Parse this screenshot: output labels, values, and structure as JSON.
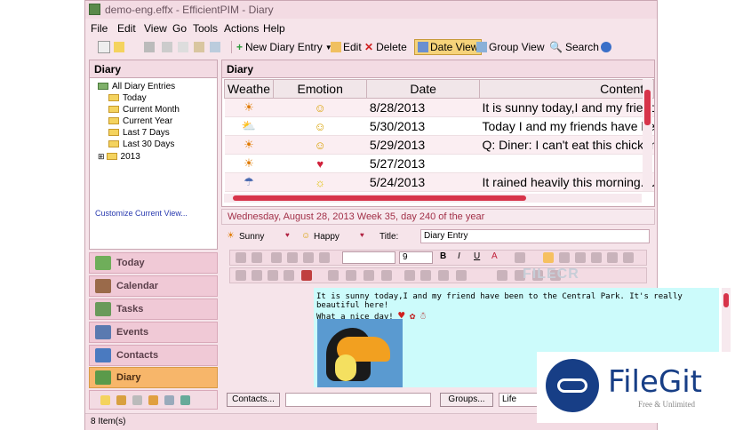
{
  "window": {
    "title": "demo-eng.effx - EfficientPIM - Diary"
  },
  "menu": [
    "File",
    "Edit",
    "View",
    "Go",
    "Tools",
    "Actions",
    "Help"
  ],
  "toolbar": {
    "new_entry": "New Diary Entry",
    "edit": "Edit",
    "delete": "Delete",
    "date_view": "Date View",
    "group_view": "Group View",
    "search": "Search"
  },
  "left_pane": {
    "title": "Diary",
    "tree": [
      "All Diary Entries",
      "Today",
      "Current Month",
      "Current Year",
      "Last 7 Days",
      "Last 30 Days",
      "2013"
    ],
    "customize": "Customize Current View..."
  },
  "nav": [
    "Today",
    "Calendar",
    "Tasks",
    "Events",
    "Contacts",
    "Diary"
  ],
  "diary": {
    "title": "Diary",
    "columns": [
      "Weathe",
      "Emotion",
      "Date",
      "Content I"
    ],
    "rows": [
      {
        "weather": "☀",
        "emotion": "☺",
        "date": "8/28/2013",
        "content": "It is sunny today,I and my friend"
      },
      {
        "weather": "⛅",
        "emotion": "☺",
        "date": "5/30/2013",
        "content": "Today I and my friends have be"
      },
      {
        "weather": "☀",
        "emotion": "☺",
        "date": "5/29/2013",
        "content": "Q: Diner: I can't eat this chicken"
      },
      {
        "weather": "☀",
        "emotion": "♥",
        "date": "5/27/2013",
        "content": ""
      },
      {
        "weather": "☂",
        "emotion": "☼",
        "date": "5/24/2013",
        "content": "It rained heavily this morning. U"
      }
    ]
  },
  "entry": {
    "date_header": "Wednesday, August 28, 2013  Week 35, day 240 of the year",
    "weather": "Sunny",
    "emotion": "Happy",
    "title_label": "Title:",
    "title_value": "Diary Entry",
    "font_size": "9",
    "text_line1": "It is sunny today,I and my friend have been to the Central Park. It's really beautiful here!",
    "text_line2": "What a nice day!"
  },
  "bottom": {
    "contacts_btn": "Contacts...",
    "groups_btn": "Groups...",
    "category": "Life"
  },
  "status": "8 Item(s)",
  "watermark": {
    "brand": "FileGit",
    "tagline": "Free & Unlimited",
    "filecr": "FILECR"
  },
  "colors": {
    "accent": "#d7344a",
    "nav_active": "#f7b66a",
    "panel": "#f6e4ea",
    "editor_bg": "#ccfbfb"
  }
}
